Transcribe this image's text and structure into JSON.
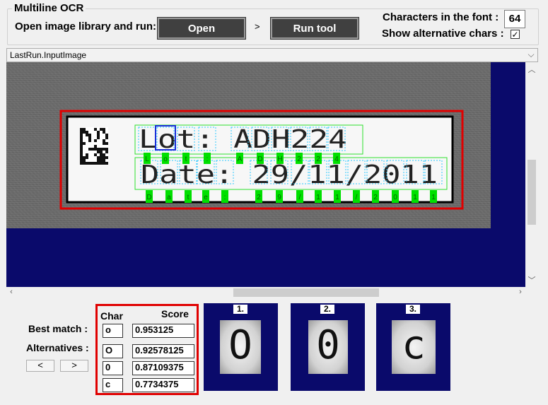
{
  "group": {
    "title": "Multiline OCR",
    "open_label": "Open image library and run:",
    "open_button": "Open",
    "arrow": ">",
    "run_button": "Run tool",
    "chars_label": "Characters in the font :",
    "chars_value": "64",
    "alt_label": "Show alternative chars :",
    "alt_checked": "✓"
  },
  "image_selector": {
    "value": "LastRun.InputImage"
  },
  "ocr_image": {
    "line1_text": "Lot: ADH224",
    "line2_text": "Date: 29/11/2011",
    "line1_markers": [
      "L",
      "o",
      "t",
      ":",
      "A",
      "D",
      "H",
      "2",
      "2",
      "4"
    ],
    "line2_markers": [
      "D",
      "a",
      "t",
      "e",
      ":",
      "2",
      "9",
      "/",
      "1",
      "1",
      "/",
      "2",
      "0",
      "1",
      "1"
    ]
  },
  "results": {
    "best_match_label": "Best match :",
    "alternatives_label": "Alternatives :",
    "prev_label": "<",
    "next_label": ">",
    "char_header": "Char",
    "score_header": "Score",
    "rows": [
      {
        "char": "o",
        "score": "0.953125"
      },
      {
        "char": "O",
        "score": "0.92578125"
      },
      {
        "char": "0",
        "score": "0.87109375"
      },
      {
        "char": "c",
        "score": "0.7734375"
      }
    ],
    "panels": [
      {
        "label": "1.",
        "glyph": "O"
      },
      {
        "label": "2.",
        "glyph": "0"
      },
      {
        "label": "3.",
        "glyph": "c"
      }
    ]
  },
  "colors": {
    "highlight": "#e00000",
    "viewer_bg": "#0a0a6b",
    "marker": "#00e000"
  }
}
